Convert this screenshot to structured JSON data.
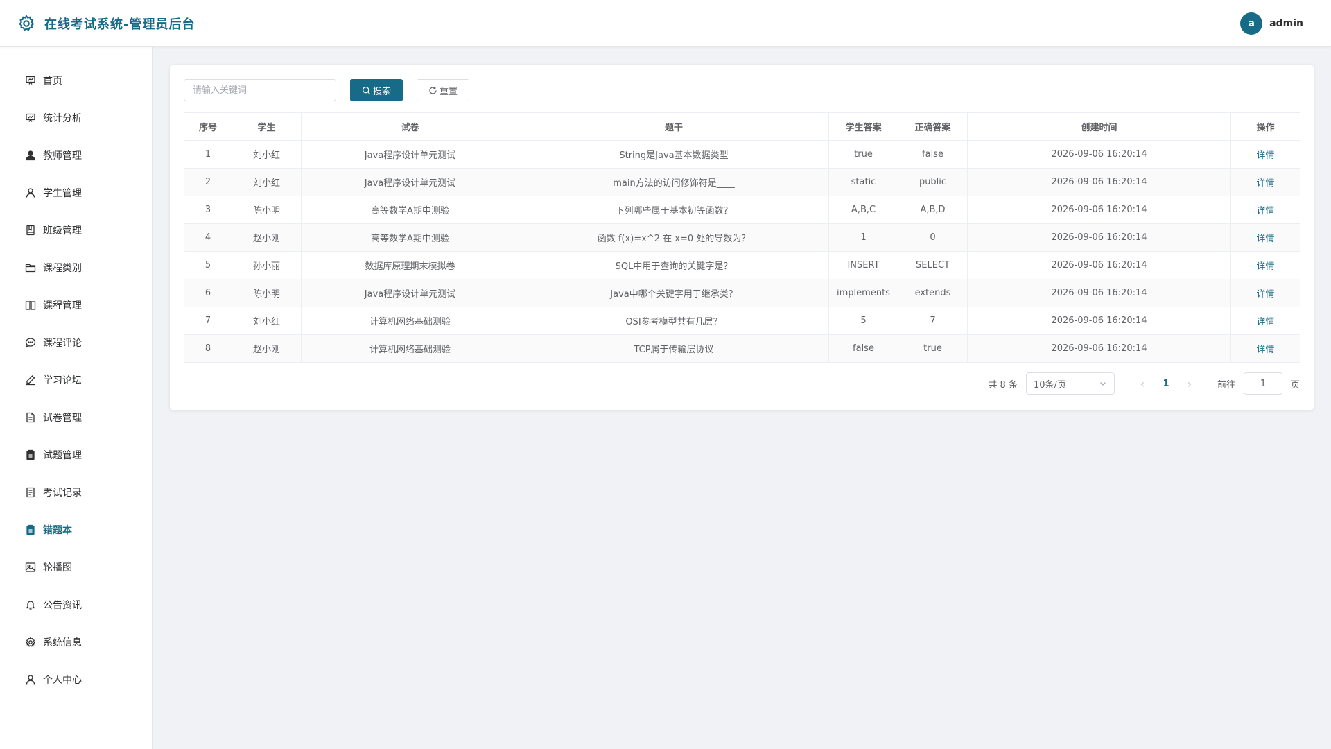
{
  "header": {
    "title": "在线考试系统-管理员后台",
    "avatar_letter": "a",
    "username": "admin"
  },
  "sidebar": {
    "items": [
      {
        "label": "首页",
        "icon": "chart-board-icon"
      },
      {
        "label": "统计分析",
        "icon": "chart-board-icon"
      },
      {
        "label": "教师管理",
        "icon": "user-filled-icon"
      },
      {
        "label": "学生管理",
        "icon": "user-icon"
      },
      {
        "label": "班级管理",
        "icon": "notebook-icon"
      },
      {
        "label": "课程类别",
        "icon": "folder-icon"
      },
      {
        "label": "课程管理",
        "icon": "book-icon"
      },
      {
        "label": "课程评论",
        "icon": "chat-icon"
      },
      {
        "label": "学习论坛",
        "icon": "edit-pen-icon"
      },
      {
        "label": "试卷管理",
        "icon": "document-icon"
      },
      {
        "label": "试题管理",
        "icon": "clipboard-icon"
      },
      {
        "label": "考试记录",
        "icon": "tickets-icon"
      },
      {
        "label": "错题本",
        "icon": "clipboard-icon",
        "active": true
      },
      {
        "label": "轮播图",
        "icon": "picture-icon"
      },
      {
        "label": "公告资讯",
        "icon": "bell-icon"
      },
      {
        "label": "系统信息",
        "icon": "setting-icon"
      },
      {
        "label": "个人中心",
        "icon": "user-icon"
      }
    ]
  },
  "toolbar": {
    "search_placeholder": "请输入关键词",
    "search_label": "搜索",
    "reset_label": "重置"
  },
  "table": {
    "headers": [
      "序号",
      "学生",
      "试卷",
      "题干",
      "学生答案",
      "正确答案",
      "创建时间",
      "操作"
    ],
    "action_label": "详情",
    "rows": [
      [
        "1",
        "刘小红",
        "Java程序设计单元测试",
        "String是Java基本数据类型",
        "true",
        "false",
        "2026-09-06 16:20:14"
      ],
      [
        "2",
        "刘小红",
        "Java程序设计单元测试",
        "main方法的访问修饰符是____",
        "static",
        "public",
        "2026-09-06 16:20:14"
      ],
      [
        "3",
        "陈小明",
        "高等数学A期中测验",
        "下列哪些属于基本初等函数？",
        "A,B,C",
        "A,B,D",
        "2026-09-06 16:20:14"
      ],
      [
        "4",
        "赵小刚",
        "高等数学A期中测验",
        "函数 f(x)=x^2 在 x=0 处的导数为？",
        "1",
        "0",
        "2026-09-06 16:20:14"
      ],
      [
        "5",
        "孙小丽",
        "数据库原理期末模拟卷",
        "SQL中用于查询的关键字是？",
        "INSERT",
        "SELECT",
        "2026-09-06 16:20:14"
      ],
      [
        "6",
        "陈小明",
        "Java程序设计单元测试",
        "Java中哪个关键字用于继承类？",
        "implements",
        "extends",
        "2026-09-06 16:20:14"
      ],
      [
        "7",
        "刘小红",
        "计算机网络基础测验",
        "OSI参考模型共有几层？",
        "5",
        "7",
        "2026-09-06 16:20:14"
      ],
      [
        "8",
        "赵小刚",
        "计算机网络基础测验",
        "TCP属于传输层协议",
        "false",
        "true",
        "2026-09-06 16:20:14"
      ]
    ]
  },
  "pagination": {
    "total_text": "共 8 条",
    "page_size": "10条/页",
    "current_page": "1",
    "goto_prefix": "前往",
    "goto_value": "1",
    "goto_suffix": "页"
  },
  "colors": {
    "primary": "#176b87",
    "background": "#f0f2f5"
  }
}
